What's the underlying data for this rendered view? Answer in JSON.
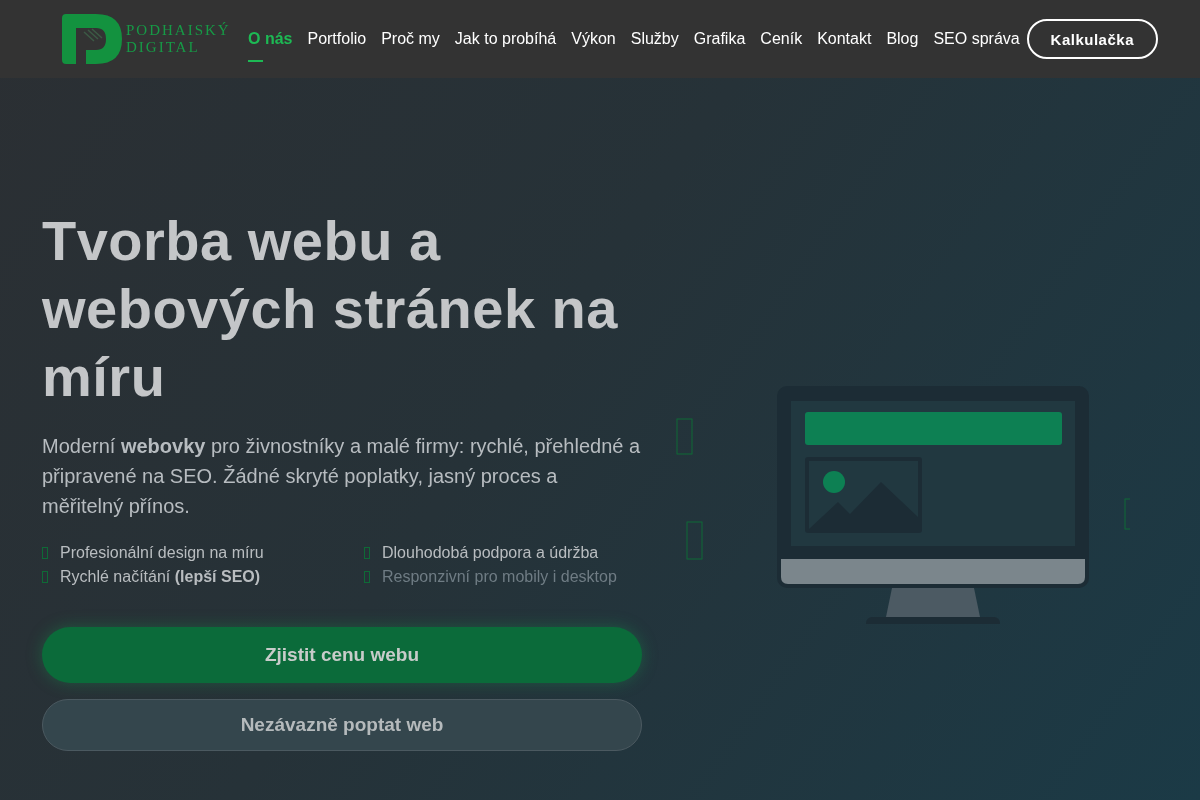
{
  "logo": {
    "line1": "PODHAISKÝ",
    "line2": "DIGITAL"
  },
  "nav": [
    {
      "label": "O nás",
      "selected": true
    },
    {
      "label": "Portfolio",
      "selected": false
    },
    {
      "label": "Proč my",
      "selected": false
    },
    {
      "label": "Jak to probíhá",
      "selected": false
    },
    {
      "label": "Výkon",
      "selected": false
    },
    {
      "label": "Služby",
      "selected": false
    },
    {
      "label": "Grafika",
      "selected": false
    },
    {
      "label": "Ceník",
      "selected": false
    },
    {
      "label": "Kontakt",
      "selected": false
    },
    {
      "label": "Blog",
      "selected": false
    },
    {
      "label": "SEO správa",
      "selected": false
    }
  ],
  "cta": "Kalkulačka",
  "hero": {
    "title": "Tvorba webu a webových stránek na míru",
    "lead": "Moderní **webovky** pro živnostníky a malé firmy: rychlé, přehledné a připravené na SEO. Žádné skryté poplatky, jasný proces a měřitelný přínos.",
    "features": [
      {
        "text": "Profesionální design na míru",
        "faded": false
      },
      {
        "text": "Dlouhodobá podpora a údržba",
        "faded": false
      },
      {
        "text": "Rychlé načítání **(lepší SEO)**",
        "faded": false
      },
      {
        "text": "Responzivní pro mobily i desktop",
        "faded": true
      }
    ],
    "primary_button": "Zjistit cenu webu",
    "secondary_button": "Nezávazně poptat web"
  }
}
